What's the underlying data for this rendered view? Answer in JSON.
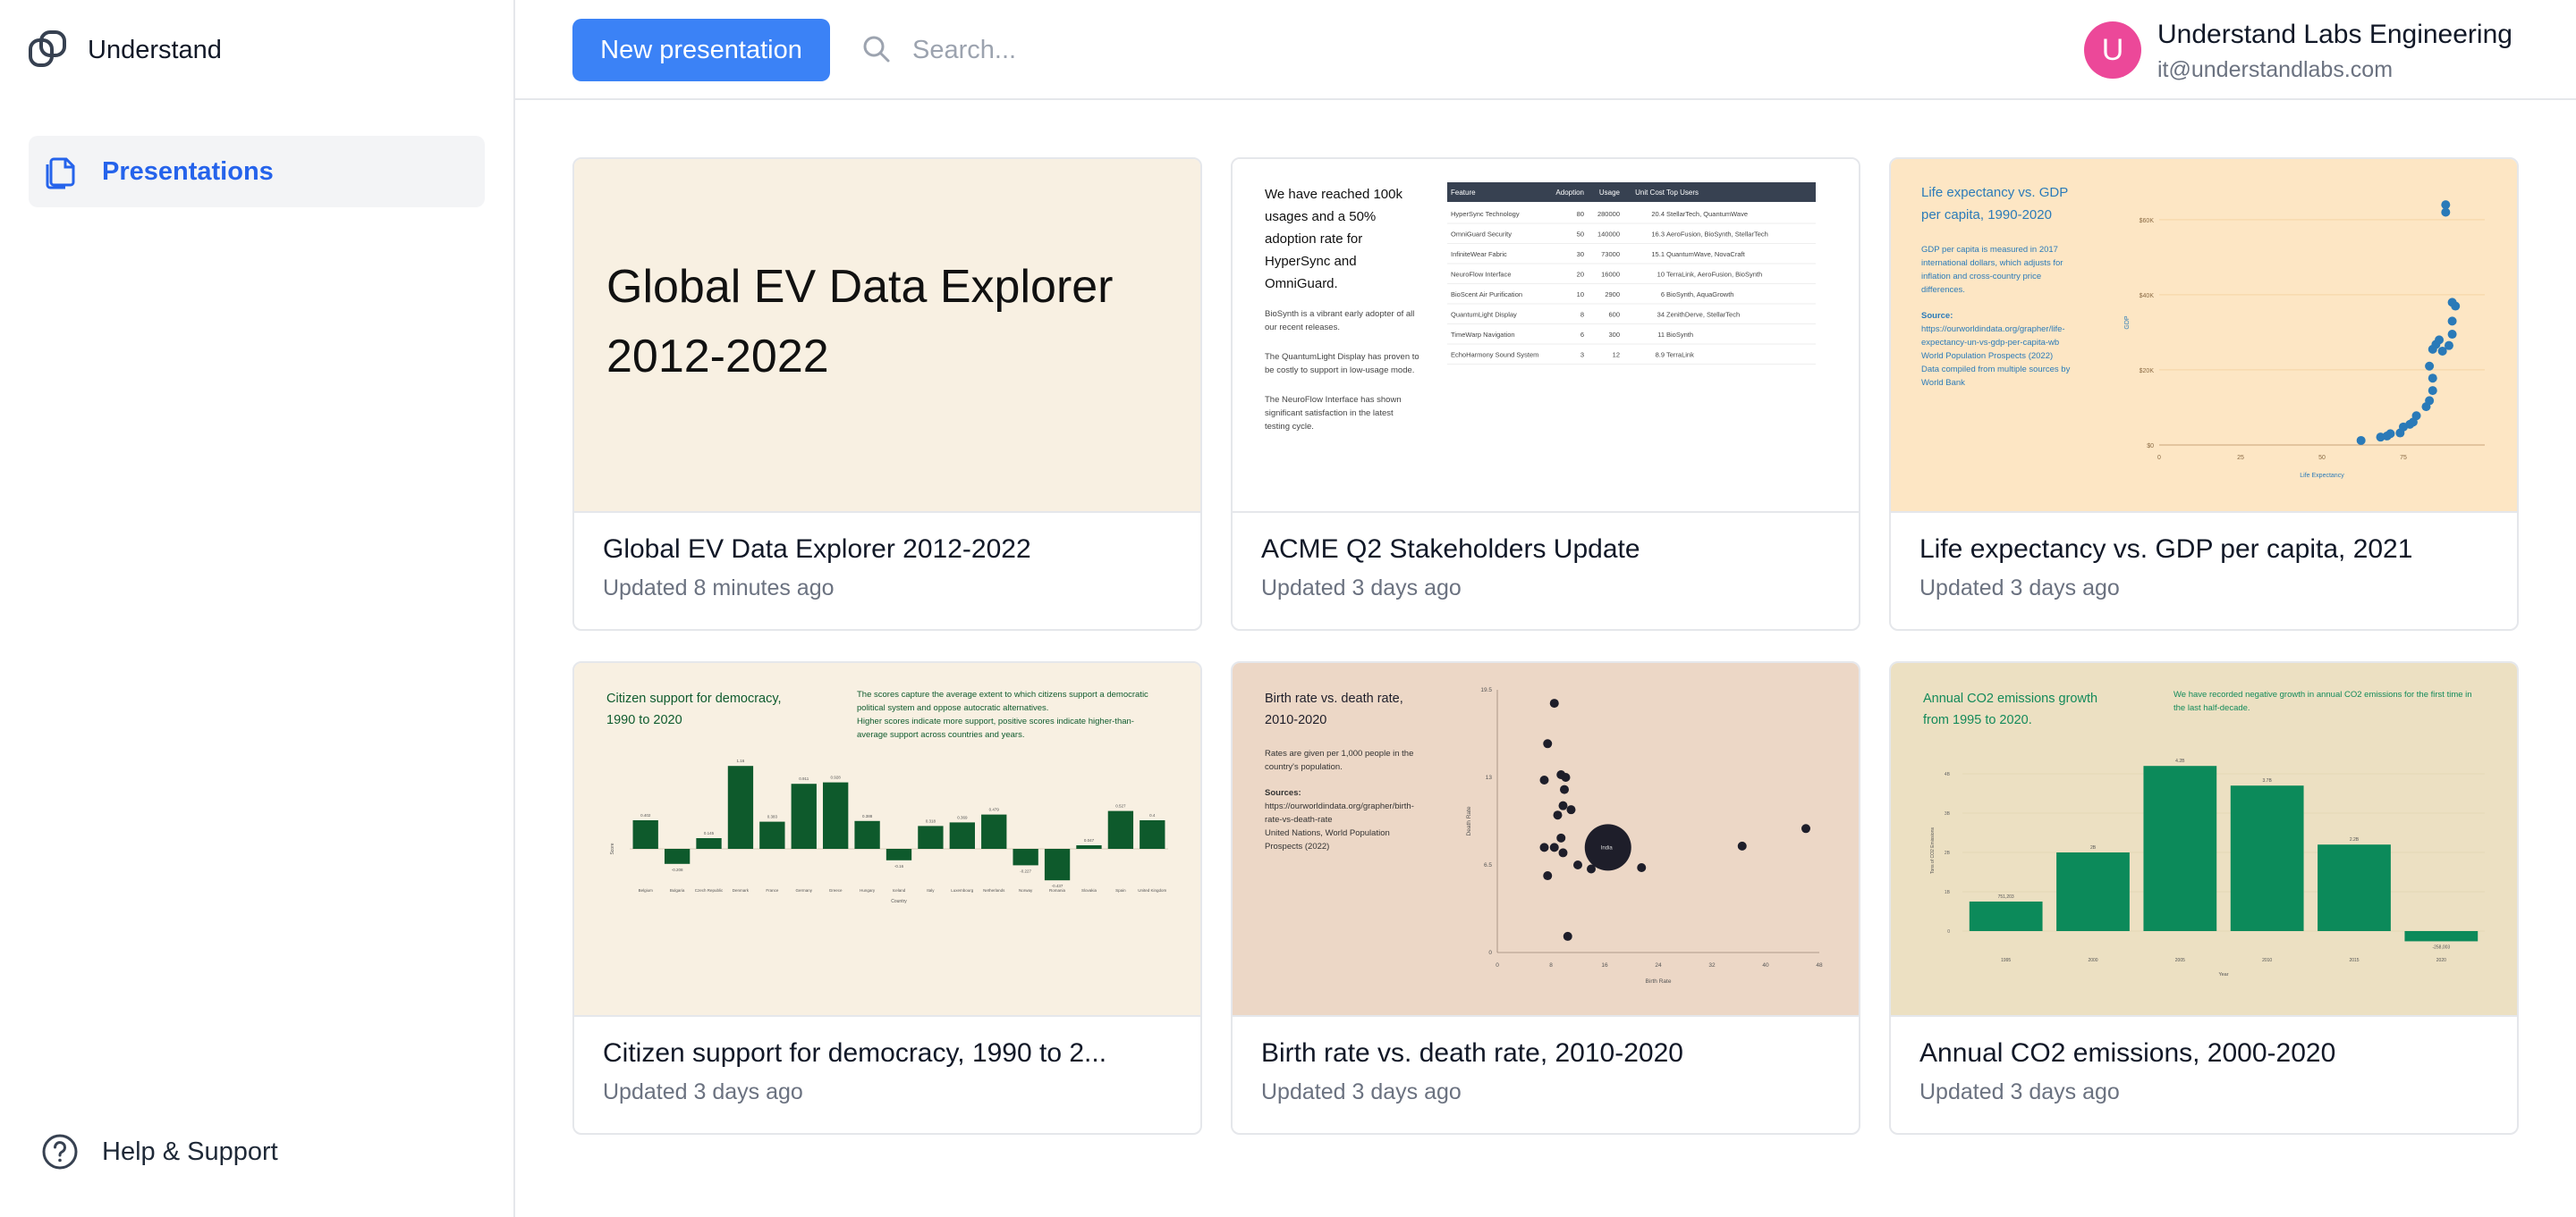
{
  "app": {
    "name": "Understand",
    "logo_icon": "understand-logo-icon"
  },
  "sidebar": {
    "items": [
      {
        "label": "Presentations",
        "icon": "copy-icon",
        "active": true
      }
    ],
    "help": {
      "label": "Help & Support",
      "icon": "help-circle-icon"
    }
  },
  "header": {
    "new_button": "New presentation",
    "search": {
      "placeholder": "Search...",
      "value": ""
    },
    "user": {
      "initial": "U",
      "name": "Understand Labs Engineering",
      "email": "it@understandlabs.com"
    }
  },
  "colors": {
    "accent": "#3b82f6",
    "active_text": "#2563eb",
    "avatar": "#ec4899"
  },
  "presentations": [
    {
      "title": "Global EV Data Explorer 2012-2022",
      "updated": "Updated 8 minutes ago",
      "thumb": {
        "bg": "#f8f0e2",
        "heading_line1": "Global EV Data Explorer",
        "heading_line2": "2012-2022"
      }
    },
    {
      "title": "ACME Q2 Stakeholders Update",
      "updated": "Updated 3 days ago",
      "thumb": {
        "bg": "#ffffff",
        "heading": [
          "We have reached 100k",
          "usages and a 50%",
          "adoption rate for",
          "HyperSync and",
          "OmniGuard."
        ],
        "paras": [
          [
            "BioSynth is a vibrant early adopter of all",
            "our recent releases."
          ],
          [
            "The QuantumLight Display has proven to",
            "be costly to support in low-usage mode."
          ],
          [
            "The NeuroFlow Interface has shown",
            "significant satisfaction in the latest",
            "testing cycle."
          ]
        ],
        "table": {
          "headers": [
            "Feature",
            "Adoption",
            "Usage",
            "Unit Cost",
            "Top Users"
          ],
          "rows": [
            [
              "HyperSync Technology",
              "80",
              "280000",
              "20.4",
              "StellarTech, QuantumWave"
            ],
            [
              "OmniGuard Security",
              "50",
              "140000",
              "16.3",
              "AeroFusion, BioSynth, StellarTech"
            ],
            [
              "InfiniteWear Fabric",
              "30",
              "73000",
              "15.1",
              "QuantumWave, NovaCraft"
            ],
            [
              "NeuroFlow Interface",
              "20",
              "16000",
              "10",
              "TerraLink, AeroFusion, BioSynth"
            ],
            [
              "BioScent Air Purification",
              "10",
              "2900",
              "6",
              "BioSynth, AquaGrowth"
            ],
            [
              "QuantumLight Display",
              "8",
              "600",
              "34",
              "ZenithDerve, StellarTech"
            ],
            [
              "TimeWarp Navigation",
              "6",
              "300",
              "11",
              "BioSynth"
            ],
            [
              "EchoHarmony Sound System",
              "3",
              "12",
              "8.9",
              "TerraLink"
            ]
          ]
        }
      }
    },
    {
      "title": "Life expectancy vs. GDP per capita, 2021",
      "updated": "Updated 3 days ago",
      "thumb": {
        "bg": "#fde6c4",
        "heading": [
          "Life expectancy vs. GDP",
          "per capita, 1990-2020"
        ],
        "body": [
          "GDP per capita is measured in 2017",
          "international dollars, which adjusts for",
          "inflation and cross-country price",
          "differences."
        ],
        "source_label": "Source:",
        "source": [
          "https://ourworldindata.org/grapher/life-",
          "expectancy-un-vs-gdp-per-capita-wb",
          "World Population Prospects (2022)",
          "Data compiled from multiple sources by",
          "World Bank"
        ],
        "xlabel": "Life Expectancy",
        "ylabel": "GDP",
        "xticks": [
          "0",
          "25",
          "50",
          "75"
        ],
        "yticks": [
          "$0",
          "$20K",
          "$40K",
          "$60K"
        ],
        "points": [
          [
            62,
            1200
          ],
          [
            68,
            2100
          ],
          [
            70,
            2400
          ],
          [
            71,
            3000
          ],
          [
            74,
            3200
          ],
          [
            75,
            4800
          ],
          [
            77,
            5500
          ],
          [
            78,
            6100
          ],
          [
            79,
            7800
          ],
          [
            82,
            10200
          ],
          [
            83,
            11800
          ],
          [
            84,
            14500
          ],
          [
            84,
            17800
          ],
          [
            83,
            21000
          ],
          [
            84,
            25500
          ],
          [
            85,
            26800
          ],
          [
            87,
            25000
          ],
          [
            86,
            28000
          ],
          [
            89,
            26500
          ],
          [
            90,
            29500
          ],
          [
            90,
            33000
          ],
          [
            91,
            37000
          ],
          [
            90,
            38000
          ],
          [
            88,
            62000
          ],
          [
            88,
            64000
          ]
        ]
      }
    },
    {
      "title": "Citizen support for democracy, 1990 to 2...",
      "updated": "Updated 3 days ago",
      "thumb": {
        "bg": "#f8f0e2",
        "heading": [
          "Citizen support for democracy,",
          "1990 to 2020"
        ],
        "body": [
          "The scores capture the average extent to which citizens support a democratic",
          "political system and oppose autocratic alternatives.",
          "Higher scores indicate more support, positive scores indicate higher-than-",
          "average support across countries and years."
        ],
        "xlabel": "Country",
        "ylabel": "Score",
        "categories": [
          "Belgium",
          "Bulgaria",
          "Czech Republic",
          "Denmark",
          "France",
          "Germany",
          "Greece",
          "Hungary",
          "Iceland",
          "Italy",
          "Luxembourg",
          "Netherlands",
          "Norway",
          "Romania",
          "Slovakia",
          "Spain",
          "United Kingdom"
        ],
        "values": [
          0.4,
          -0.21,
          0.15,
          1.16,
          0.38,
          0.91,
          0.93,
          0.39,
          -0.16,
          0.32,
          0.37,
          0.48,
          -0.23,
          -0.44,
          0.05,
          0.53,
          0.4
        ],
        "labels": [
          "0.402",
          "-0.208",
          "0.145",
          "1.16",
          "0.383",
          "0.911",
          "0.928",
          "0.388",
          "-0.16",
          "0.318",
          "0.369",
          "0.479",
          "-0.227",
          "-0.437",
          "0.047",
          "0.527",
          "0.4"
        ]
      }
    },
    {
      "title": "Birth rate vs. death rate, 2010-2020",
      "updated": "Updated 3 days ago",
      "thumb": {
        "bg": "#ecd7c6",
        "heading": [
          "Birth rate vs. death rate,",
          "2010-2020"
        ],
        "body": [
          "Rates are given per 1,000 people in the",
          "country's population."
        ],
        "source_label": "Sources:",
        "source": [
          "https://ourworldindata.org/grapher/birth-",
          "rate-vs-death-rate",
          "United Nations, World Population",
          "Prospects (2022)"
        ],
        "xlabel": "Birth Rate",
        "ylabel": "Death Rate",
        "xticks": [
          "0",
          "8",
          "16",
          "24",
          "32",
          "40",
          "48"
        ],
        "yticks": [
          "0",
          "6.5",
          "13",
          "19.5"
        ],
        "points": [
          [
            8.5,
            18.5
          ],
          [
            7.5,
            15.5
          ],
          [
            9.5,
            13.2
          ],
          [
            10.2,
            13
          ],
          [
            7,
            12.8
          ],
          [
            10,
            12.1
          ],
          [
            9.8,
            10.9
          ],
          [
            9,
            10.2
          ],
          [
            11,
            10.6
          ],
          [
            9.5,
            8.5
          ],
          [
            7,
            7.8
          ],
          [
            8.5,
            7.8
          ],
          [
            9.8,
            7.4
          ],
          [
            12,
            6.5
          ],
          [
            7.5,
            5.7
          ],
          [
            15.5,
            8
          ],
          [
            16,
            7.2
          ],
          [
            18,
            6.8
          ],
          [
            14,
            6.2
          ],
          [
            21.5,
            6.3
          ],
          [
            36.5,
            7.9
          ],
          [
            46,
            9.2
          ],
          [
            10.5,
            1.2
          ]
        ],
        "bubble": {
          "x": 16.5,
          "y": 7.8,
          "label": "India"
        }
      }
    },
    {
      "title": "Annual CO2 emissions, 2000-2020",
      "updated": "Updated 3 days ago",
      "thumb": {
        "bg": "#ece0c2",
        "heading": [
          "Annual CO2 emissions growth",
          "from 1995 to 2020."
        ],
        "body": [
          "We have recorded negative growth in annual CO2 emissions for the first time in",
          "the last half-decade."
        ],
        "xlabel": "Year",
        "ylabel": "Tons of CO2 Emissions",
        "categories": [
          "1995",
          "2000",
          "2005",
          "2010",
          "2015",
          "2020"
        ],
        "values": [
          0.751,
          2.0,
          4.2,
          3.7,
          2.2,
          -0.26
        ],
        "labels": [
          "751,203",
          "2B",
          "4.2B",
          "3.7B",
          "2.2B",
          "-258,003"
        ],
        "yticks": [
          "0",
          "1B",
          "2B",
          "3B",
          "4B"
        ]
      }
    }
  ]
}
